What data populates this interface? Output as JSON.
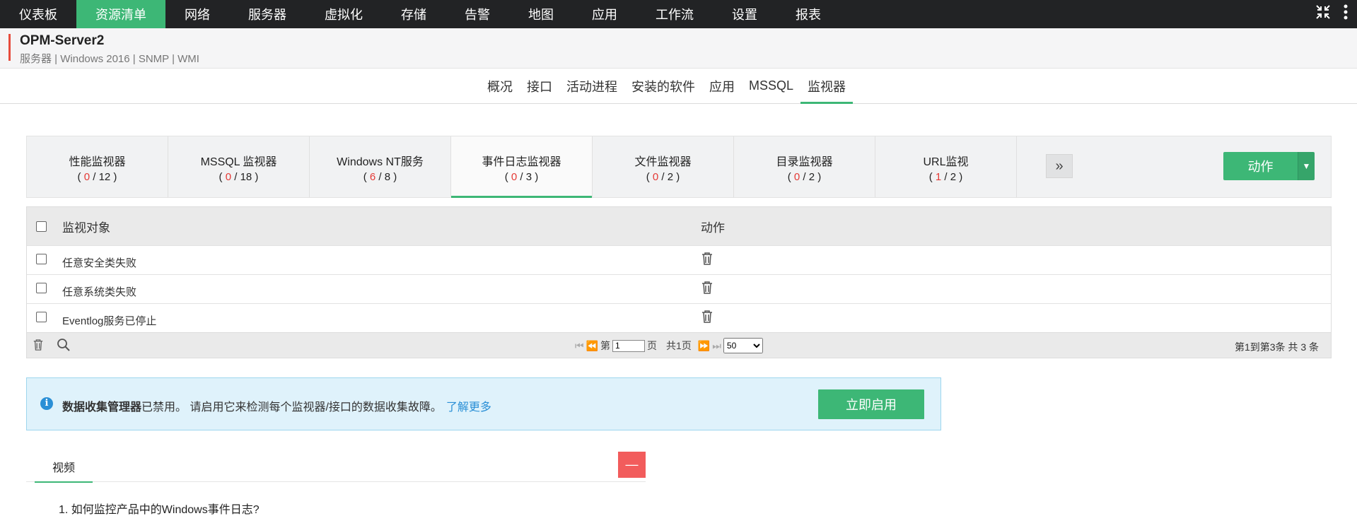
{
  "topnav": {
    "items": [
      "仪表板",
      "资源清单",
      "网络",
      "服务器",
      "虚拟化",
      "存储",
      "告警",
      "地图",
      "应用",
      "工作流",
      "设置",
      "报表"
    ],
    "active_index": 1,
    "icons": [
      "collapse-icon",
      "more-vertical-icon"
    ]
  },
  "device": {
    "name": "OPM-Server2",
    "meta": "服务器 | Windows 2016  | SNMP  | WMI"
  },
  "subtabs": {
    "items": [
      "概况",
      "接口",
      "活动进程",
      "安装的软件",
      "应用",
      "MSSQL",
      "监视器"
    ],
    "active_index": 6
  },
  "monitor_tabs": [
    {
      "label": "性能监视器",
      "num": "0",
      "total": "12"
    },
    {
      "label": "MSSQL 监视器",
      "num": "0",
      "total": "18"
    },
    {
      "label": "Windows NT服务",
      "num": "6",
      "total": "8"
    },
    {
      "label": "事件日志监视器",
      "num": "0",
      "total": "3"
    },
    {
      "label": "文件监视器",
      "num": "0",
      "total": "2"
    },
    {
      "label": "目录监视器",
      "num": "0",
      "total": "2"
    },
    {
      "label": "URL监视",
      "num": "1",
      "total": "2"
    }
  ],
  "monitor_active_index": 3,
  "action_button": {
    "label": "动作"
  },
  "table": {
    "headers": [
      "监视对象",
      "动作"
    ],
    "rows": [
      {
        "name": "任意安全类失败"
      },
      {
        "name": "任意系统类失败"
      },
      {
        "name": "Eventlog服务已停止"
      }
    ],
    "pager": {
      "page_prefix": "第",
      "page_value": "1",
      "page_suffix": "页",
      "total_pages": "共1页",
      "page_size": "50",
      "page_size_options": [
        "50"
      ]
    },
    "summary": "第1到第3条    共 3 条"
  },
  "info": {
    "bold": "数据收集管理器",
    "text": "已禁用。 请启用它来检测每个监视器/接口的数据收集故障。",
    "link": "了解更多",
    "button": "立即启用"
  },
  "video": {
    "tab": "视频",
    "question": "1. 如何监控产品中的Windows事件日志?"
  },
  "colors": {
    "nav_bg": "#222325",
    "accent_green": "#3db776",
    "count_red": "#e53935",
    "info_bg": "#dff2fb",
    "collapse_red": "#f25c5c"
  }
}
